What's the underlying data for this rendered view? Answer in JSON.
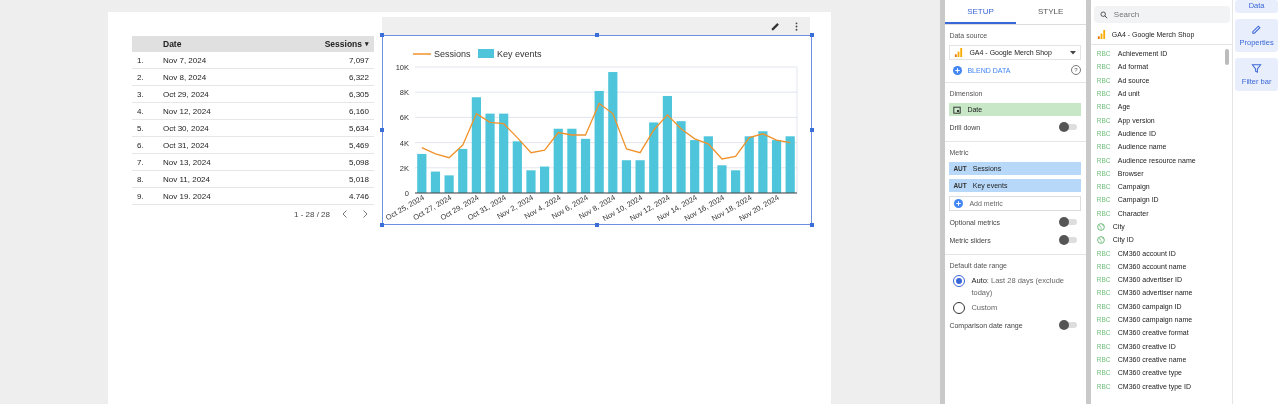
{
  "table": {
    "columns": [
      "Date",
      "Sessions"
    ],
    "sort_indicator": "▾",
    "rows": [
      {
        "index": "1.",
        "date": "Nov 7, 2024",
        "sessions": "7,097"
      },
      {
        "index": "2.",
        "date": "Nov 8, 2024",
        "sessions": "6,322"
      },
      {
        "index": "3.",
        "date": "Oct 29, 2024",
        "sessions": "6,305"
      },
      {
        "index": "4.",
        "date": "Nov 12, 2024",
        "sessions": "6,160"
      },
      {
        "index": "5.",
        "date": "Oct 30, 2024",
        "sessions": "5,634"
      },
      {
        "index": "6.",
        "date": "Oct 31, 2024",
        "sessions": "5,469"
      },
      {
        "index": "7.",
        "date": "Nov 13, 2024",
        "sessions": "5,098"
      },
      {
        "index": "8.",
        "date": "Nov 11, 2024",
        "sessions": "5,018"
      },
      {
        "index": "9.",
        "date": "Nov 19. 2024",
        "sessions": "4.746"
      }
    ],
    "pagination": "1 - 28 / 28"
  },
  "chart": {
    "chart_data": {
      "type": "bar",
      "categories": [
        "Oct 25, 2024",
        null,
        "Oct 27, 2024",
        null,
        "Oct 29, 2024",
        null,
        "Oct 31, 2024",
        null,
        "Nov 2, 2024",
        null,
        "Nov 4, 2024",
        null,
        "Nov 6, 2024",
        null,
        "Nov 8, 2024",
        null,
        "Nov 10, 2024",
        null,
        "Nov 12, 2024",
        null,
        "Nov 14, 2024",
        null,
        "Nov 16, 2024",
        null,
        "Nov 18, 2024",
        null,
        "Nov 20, 2024",
        null
      ],
      "series": [
        {
          "name": "Sessions",
          "color": "#f0922b",
          "type": "line",
          "values": [
            3600,
            3100,
            2800,
            3800,
            6300,
            5600,
            5500,
            4400,
            3200,
            3400,
            4800,
            4600,
            4600,
            7100,
            6300,
            3500,
            3200,
            5000,
            6200,
            5100,
            4300,
            3900,
            2700,
            2900,
            4400,
            4700,
            4200,
            4000
          ]
        },
        {
          "name": "Key events",
          "color": "#4ec5da",
          "type": "bar",
          "values": [
            3100,
            1700,
            1400,
            3500,
            7600,
            6300,
            6300,
            4100,
            1800,
            2100,
            5100,
            5100,
            4300,
            8100,
            9600,
            2600,
            2600,
            5600,
            7700,
            5700,
            4200,
            4500,
            2200,
            1800,
            4500,
            4900,
            4200,
            4500
          ]
        }
      ],
      "ylim": [
        0,
        10000
      ],
      "grid": true,
      "legend": true,
      "yticks": [
        {
          "value": 0,
          "label": "0"
        },
        {
          "value": 2000,
          "label": "2K"
        },
        {
          "value": 4000,
          "label": "4K"
        },
        {
          "value": 6000,
          "label": "6K"
        },
        {
          "value": 8000,
          "label": "8K"
        },
        {
          "value": 10000,
          "label": "10K"
        }
      ]
    }
  },
  "setup": {
    "tabs": [
      {
        "label": "SETUP",
        "selected": true
      },
      {
        "label": "STYLE",
        "selected": false
      }
    ],
    "data_source_label": "Data source",
    "data_source": "GA4 - Google Merch Shop",
    "blend_data": "BLEND DATA",
    "help": "?",
    "dimension_label": "Dimension",
    "dimension": "Date",
    "drill_down": {
      "label": "Drill down",
      "on": false
    },
    "metric_label": "Metric",
    "metrics": [
      {
        "type": "AUT",
        "name": "Sessions"
      },
      {
        "type": "AUT",
        "name": "Key events"
      }
    ],
    "add_metric": "Add metric",
    "optional_metrics": {
      "label": "Optional metrics",
      "on": false
    },
    "metric_sliders": {
      "label": "Metric sliders",
      "on": false
    },
    "date_range_label": "Default date range",
    "date_options": [
      {
        "label": "**Auto**: Last 28 days (exclude today)",
        "selected": true
      },
      {
        "label": "Custom",
        "selected": false
      }
    ],
    "comparison": {
      "label": "Comparison date range",
      "on": false
    }
  },
  "fields": {
    "search_placeholder": "Search",
    "source": "GA4 - Google Merch Shop",
    "items": [
      {
        "kind": "text",
        "badge": "RBC",
        "name": "Achievement ID"
      },
      {
        "kind": "text",
        "badge": "RBC",
        "name": "Ad format"
      },
      {
        "kind": "text",
        "badge": "RBC",
        "name": "Ad source"
      },
      {
        "kind": "text",
        "badge": "RBC",
        "name": "Ad unit"
      },
      {
        "kind": "text",
        "badge": "RBC",
        "name": "Age"
      },
      {
        "kind": "text",
        "badge": "RBC",
        "name": "App version"
      },
      {
        "kind": "text",
        "badge": "RBC",
        "name": "Audience ID"
      },
      {
        "kind": "text",
        "badge": "RBC",
        "name": "Audience name"
      },
      {
        "kind": "text",
        "badge": "RBC",
        "name": "Audience resource name"
      },
      {
        "kind": "text",
        "badge": "RBC",
        "name": "Browser"
      },
      {
        "kind": "text",
        "badge": "RBC",
        "name": "Campaign"
      },
      {
        "kind": "text",
        "badge": "RBC",
        "name": "Campaign ID"
      },
      {
        "kind": "text",
        "badge": "RBC",
        "name": "Character"
      },
      {
        "kind": "geo",
        "name": "City"
      },
      {
        "kind": "geo",
        "name": "City ID"
      },
      {
        "kind": "text",
        "badge": "RBC",
        "name": "CM360 account ID"
      },
      {
        "kind": "text",
        "badge": "RBC",
        "name": "CM360 account name"
      },
      {
        "kind": "text",
        "badge": "RBC",
        "name": "CM360 advertiser ID"
      },
      {
        "kind": "text",
        "badge": "RBC",
        "name": "CM360 advertiser name"
      },
      {
        "kind": "text",
        "badge": "RBC",
        "name": "CM360 campaign ID"
      },
      {
        "kind": "text",
        "badge": "RBC",
        "name": "CM360 campaign name"
      },
      {
        "kind": "text",
        "badge": "RBC",
        "name": "CM360 creative format"
      },
      {
        "kind": "text",
        "badge": "RBC",
        "name": "CM360 creative ID"
      },
      {
        "kind": "text",
        "badge": "RBC",
        "name": "CM360 creative name"
      },
      {
        "kind": "text",
        "badge": "RBC",
        "name": "CM360 creative type"
      },
      {
        "kind": "text",
        "badge": "RBC",
        "name": "CM360 creative type ID"
      }
    ]
  },
  "rail": [
    {
      "kind": "data",
      "label": "Data"
    },
    {
      "kind": "properties",
      "label": "Properties"
    },
    {
      "kind": "filter",
      "label": "Filter bar"
    }
  ]
}
